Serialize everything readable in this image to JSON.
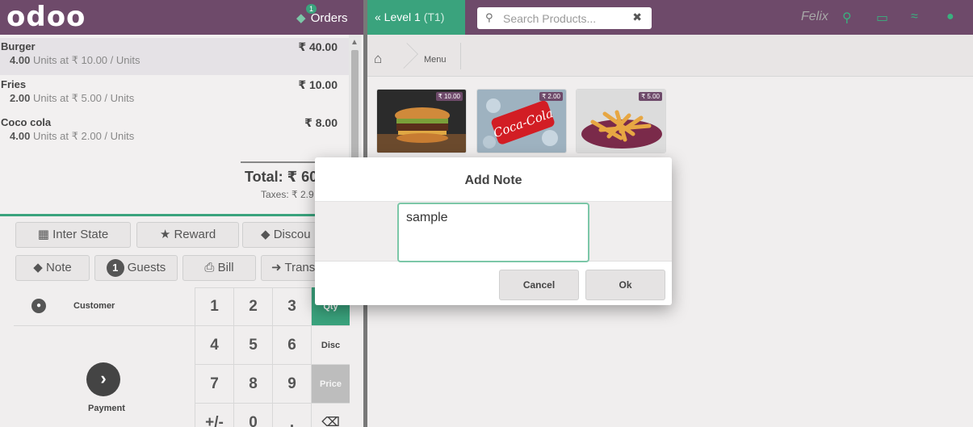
{
  "topbar": {
    "logo": "odoo",
    "orders_label": "Orders",
    "orders_count": "1",
    "level_label": "« Level 1",
    "level_table": "(T1)",
    "search_placeholder": "Search Products...",
    "user": "Felix"
  },
  "order": {
    "lines": [
      {
        "name": "Burger",
        "price": "₹ 40.00",
        "qty": "4.00",
        "info": "Units at ₹ 10.00 / Units"
      },
      {
        "name": "Fries",
        "price": "₹ 10.00",
        "qty": "2.00",
        "info": "Units at ₹ 5.00 / Units"
      },
      {
        "name": "Coco cola",
        "price": "₹ 8.00",
        "qty": "4.00",
        "info": "Units at ₹ 2.00 / Units"
      }
    ],
    "total": "Total: ₹ 60",
    "taxes": "Taxes: ₹ 2.9"
  },
  "controls": {
    "inter_state": "Inter State",
    "reward": "Reward",
    "discount": "Discou",
    "note": "Note",
    "guests_count": "1",
    "guests": "Guests",
    "bill": "Bill",
    "transfer": "Trans"
  },
  "numpad": {
    "customer": "Customer",
    "payment": "Payment",
    "keys": [
      "1",
      "2",
      "3",
      "4",
      "5",
      "6",
      "7",
      "8",
      "9",
      "+/-",
      "0",
      "."
    ],
    "modes": [
      "Qty",
      "Disc",
      "Price"
    ],
    "backspace": "⌫"
  },
  "products_header": {
    "crumb": "Menu"
  },
  "products": [
    {
      "name": "Burger",
      "price": "₹ 10.00"
    },
    {
      "name": "Coca-Cola",
      "price": "₹ 2.00"
    },
    {
      "name": "Fries",
      "price": "₹ 5.00"
    }
  ],
  "modal": {
    "title": "Add Note",
    "value": "sample",
    "cancel": "Cancel",
    "ok": "Ok"
  },
  "colors": {
    "topbar": "#6e4a6a",
    "accent": "#3aa37d"
  }
}
